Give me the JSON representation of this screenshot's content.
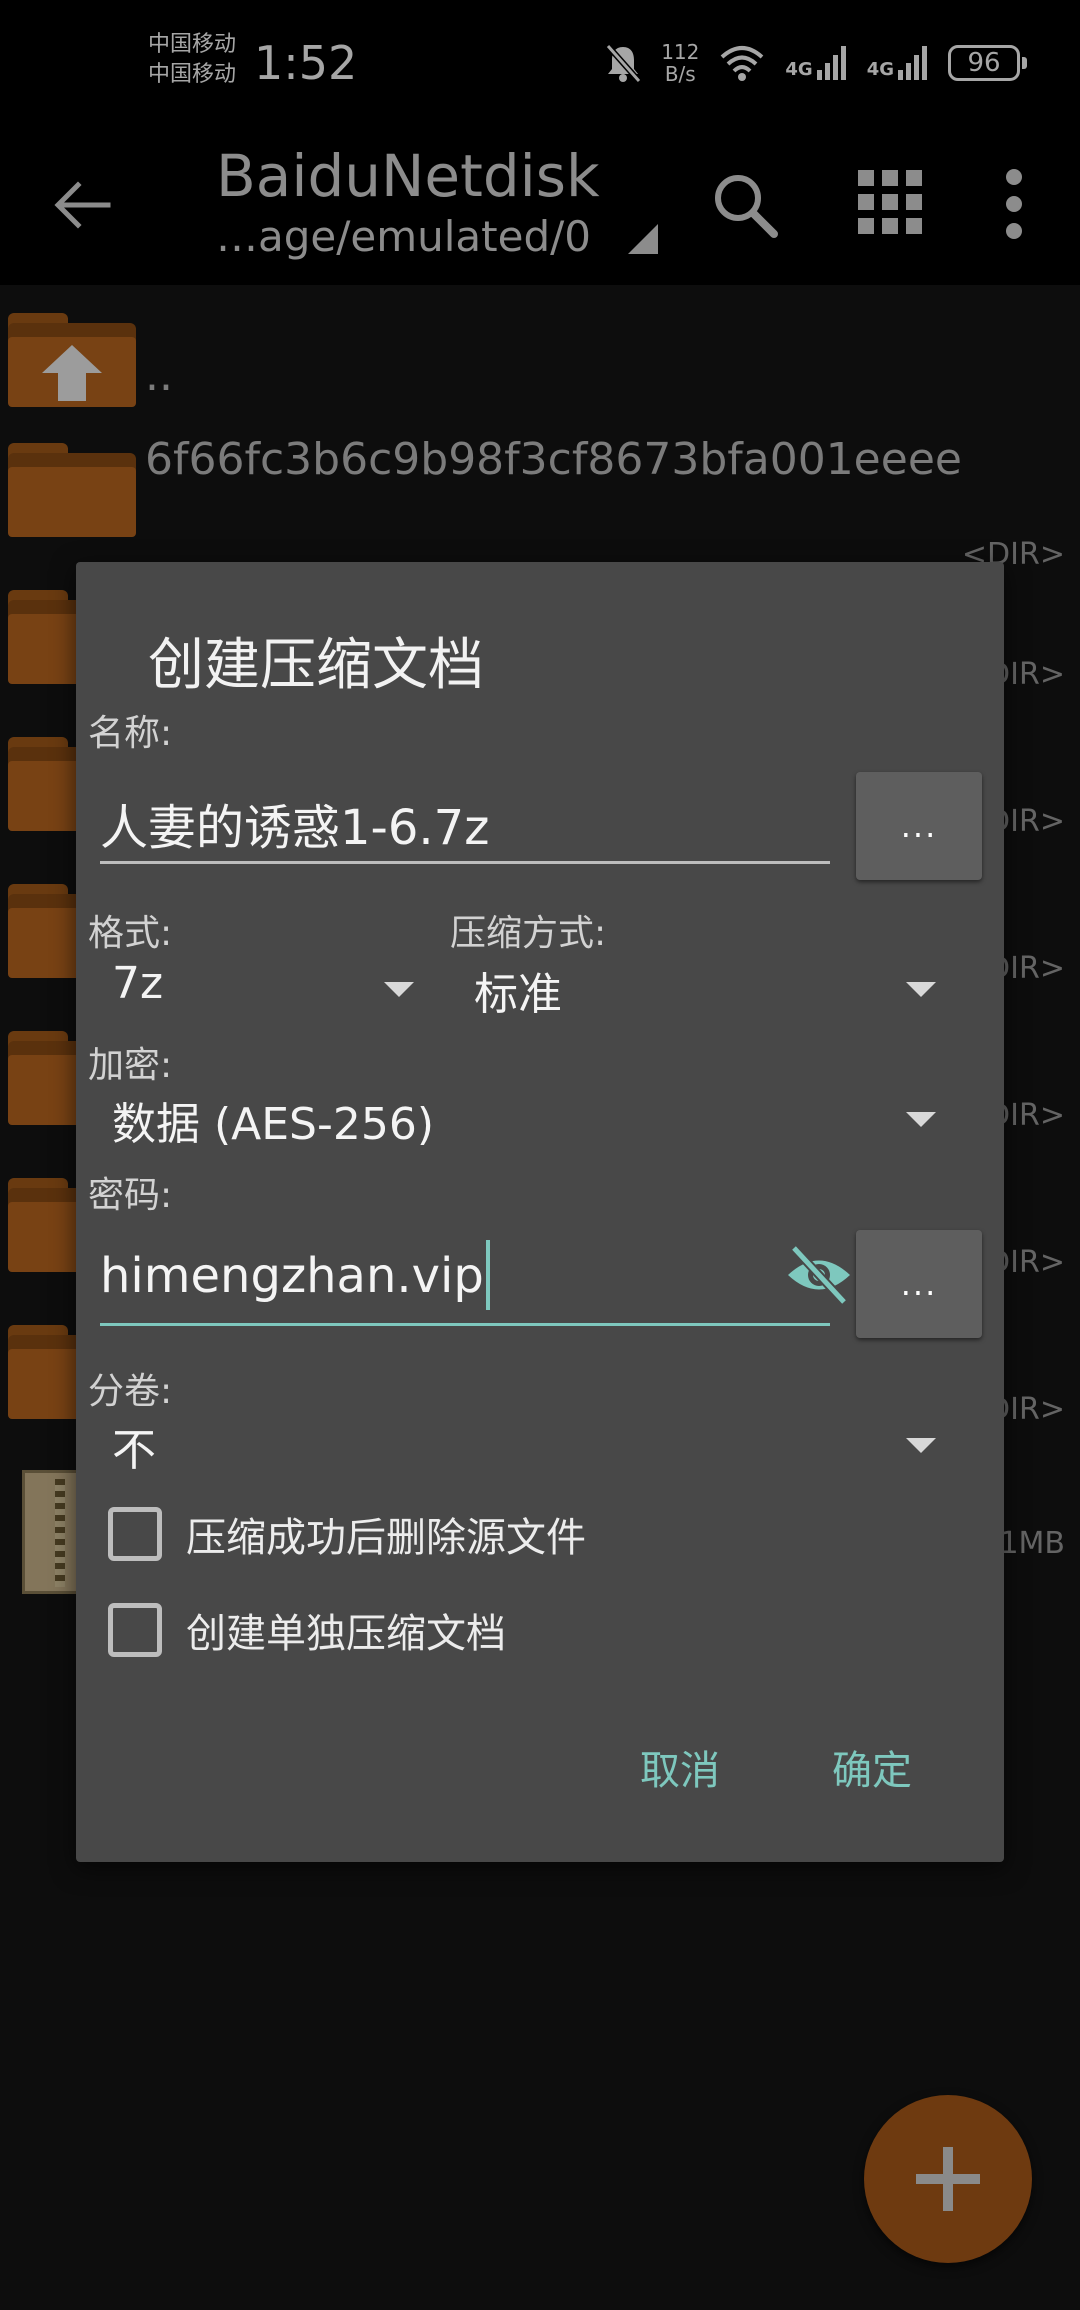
{
  "status_bar": {
    "carrier_1": "中国移动",
    "carrier_2": "中国移动",
    "time": "1:52",
    "net_speed_value": "112",
    "net_speed_unit": "B/s",
    "sim1_type": "4G",
    "sim2_type": "4G",
    "battery": "96"
  },
  "toolbar": {
    "title": "BaiduNetdisk",
    "path": "…age/emulated/0"
  },
  "file_list": {
    "parent": "..",
    "items": [
      {
        "name": "6f66fc3b6c9b98f3cf8673bfa001eeee",
        "meta": "<DIR>"
      },
      {
        "name": "",
        "meta": "<DIR>"
      },
      {
        "name": "",
        "meta": "<DIR>"
      },
      {
        "name": "",
        "meta": "<DIR>"
      },
      {
        "name": "",
        "meta": "<DIR>"
      },
      {
        "name": "",
        "meta": "<DIR>"
      },
      {
        "name": "",
        "meta": "<DIR>"
      },
      {
        "name": "",
        "meta": "1MB"
      }
    ]
  },
  "dialog": {
    "title": "创建压缩文档",
    "name_label": "名称:",
    "name_value": "人妻的诱惑1-6.7z",
    "browse_label": "...",
    "format_label": "格式:",
    "format_value": "7z",
    "method_label": "压缩方式:",
    "method_value": "标准",
    "encryption_label": "加密:",
    "encryption_value": "数据 (AES-256)",
    "password_label": "密码:",
    "password_value": "himengzhan.vip",
    "password_more_label": "...",
    "volume_label": "分卷:",
    "volume_value": "不",
    "checkbox_delete": {
      "label": "压缩成功后删除源文件",
      "checked": false
    },
    "checkbox_separate": {
      "label": "创建单独压缩文档",
      "checked": false
    },
    "cancel": "取消",
    "ok": "确定"
  },
  "colors": {
    "accent": "#7ec8be",
    "folder": "#b8661f",
    "dialog_bg": "#484848",
    "fab": "#6e3a10"
  },
  "icons": [
    "back-arrow-icon",
    "search-icon",
    "grid-view-icon",
    "more-vert-icon",
    "folder-icon",
    "folder-up-icon",
    "zip-file-icon",
    "visibility-off-icon",
    "dropdown-arrow-icon",
    "plus-icon",
    "mute-bell-icon",
    "wifi-icon",
    "signal-icon"
  ]
}
